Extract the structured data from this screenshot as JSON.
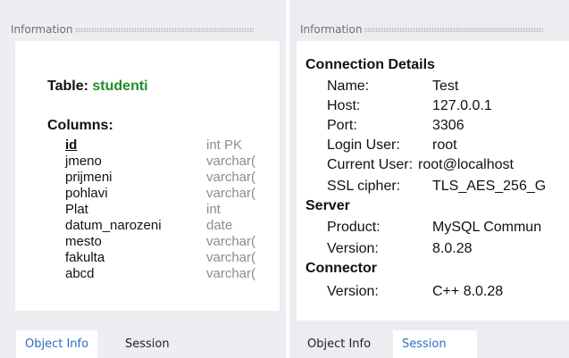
{
  "left": {
    "header": "Information",
    "table_label": "Table:",
    "table_name": "studenti",
    "columns_label": "Columns:",
    "columns": [
      {
        "name": "id",
        "type": "int PK"
      },
      {
        "name": "jmeno",
        "type": "varchar("
      },
      {
        "name": "prijmeni",
        "type": "varchar("
      },
      {
        "name": "pohlavi",
        "type": "varchar("
      },
      {
        "name": "Plat",
        "type": "int"
      },
      {
        "name": "datum_narozeni",
        "type": "date"
      },
      {
        "name": "mesto",
        "type": "varchar("
      },
      {
        "name": "fakulta",
        "type": "varchar("
      },
      {
        "name": "abcd",
        "type": "varchar("
      }
    ],
    "tabs": [
      "Object Info",
      "Session"
    ]
  },
  "right": {
    "header": "Information",
    "sections": {
      "connection_title": "Connection Details",
      "server_title": "Server",
      "connector_title": "Connector"
    },
    "connection": [
      {
        "label": "Name:",
        "value": "Test"
      },
      {
        "label": "Host:",
        "value": "127.0.0.1"
      },
      {
        "label": "Port:",
        "value": "3306"
      },
      {
        "label": "Login User:",
        "value": "root"
      },
      {
        "label": "Current User:",
        "value": "root@localhost"
      },
      {
        "label": "SSL cipher:",
        "value": "TLS_AES_256_G"
      }
    ],
    "server": [
      {
        "label": "Product:",
        "value": "MySQL Commun"
      },
      {
        "label": "Version:",
        "value": "8.0.28"
      }
    ],
    "connector": [
      {
        "label": "Version:",
        "value": "C++ 8.0.28"
      }
    ],
    "tabs": [
      "Object Info",
      "Session"
    ]
  },
  "colors": {
    "table_name": "#1a8f26",
    "active_tab_text": "#2a6fc0",
    "panel_bg": "#eceef1"
  }
}
